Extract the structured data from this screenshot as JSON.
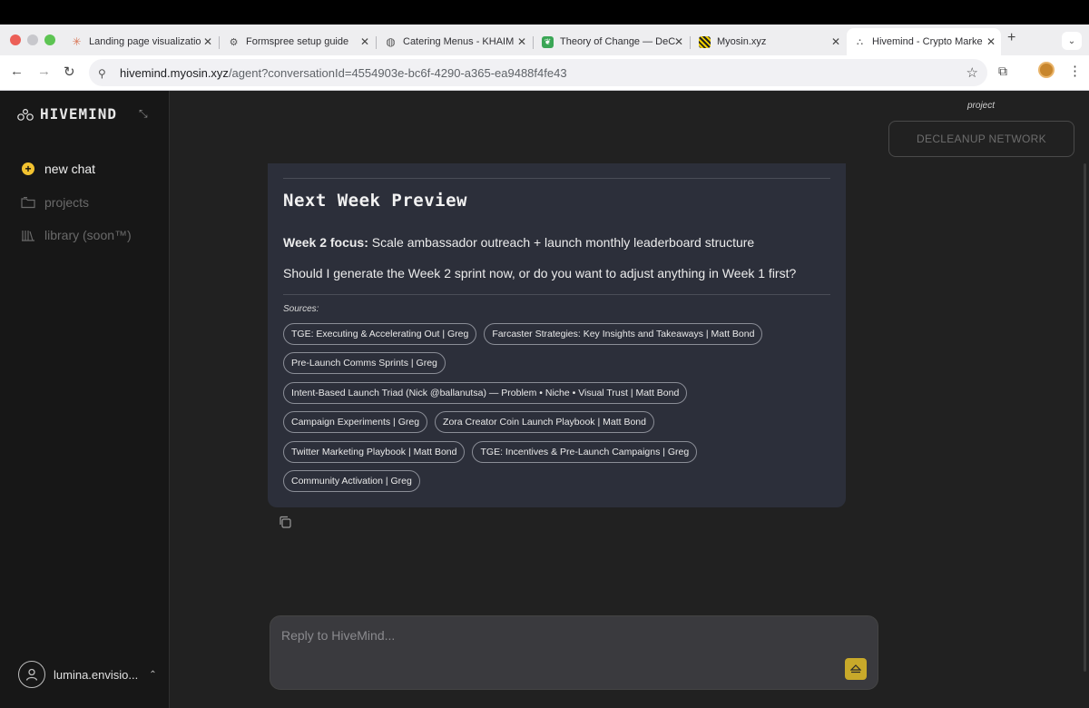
{
  "browser": {
    "tabs": [
      {
        "title": "Landing page visualizatio",
        "favicon": "claude-sunburst-icon",
        "active": false
      },
      {
        "title": "Formspree setup guide",
        "favicon": "openai-icon",
        "active": false
      },
      {
        "title": "Catering Menus - KHAIM",
        "favicon": "globe-icon",
        "active": false
      },
      {
        "title": "Theory of Change — DeC",
        "favicon": "green-leaf-icon",
        "active": false
      },
      {
        "title": "Myosin.xyz",
        "favicon": "myosin-stripes-icon",
        "active": false
      },
      {
        "title": "Hivemind - Crypto Marke",
        "favicon": "hivemind-icon",
        "active": true
      }
    ],
    "new_tab": "+",
    "url_host": "hivemind.myosin.xyz",
    "url_path": "/agent?conversationId=4554903e-bc6f-4290-a365-ea9488f4fe43"
  },
  "sidebar": {
    "brand": "HIVEMIND",
    "items": [
      {
        "label": "new chat",
        "icon": "plus-circle-icon"
      },
      {
        "label": "projects",
        "icon": "folder-icon"
      },
      {
        "label": "library (soon™)",
        "icon": "library-icon"
      }
    ],
    "user": "lumina.envisio..."
  },
  "header": {
    "project_label": "project",
    "project_name": "DECLEANUP NETWORK"
  },
  "message": {
    "heading": "Next Week Preview",
    "focus_label": "Week 2 focus:",
    "focus_text": "Scale ambassador outreach + launch monthly leaderboard structure",
    "question": "Should I generate the Week 2 sprint now, or do you want to adjust anything in Week 1 first?",
    "sources_label": "Sources:",
    "sources": [
      [
        "TGE: Executing & Accelerating Out | Greg",
        "Farcaster Strategies: Key Insights and Takeaways | Matt Bond"
      ],
      [
        "Pre-Launch Comms Sprints | Greg"
      ],
      [
        "Intent-Based Launch Triad (Nick @ballanutsa) — Problem • Niche • Visual Trust | Matt Bond"
      ],
      [
        "Campaign Experiments | Greg",
        "Zora Creator Coin Launch Playbook | Matt Bond"
      ],
      [
        "Twitter Marketing Playbook | Matt Bond",
        "TGE: Incentives & Pre-Launch Campaigns | Greg"
      ],
      [
        "Community Activation | Greg"
      ]
    ]
  },
  "composer": {
    "placeholder": "Reply to HiveMind..."
  },
  "colors": {
    "accent": "#f2c230",
    "send_button": "#c8a92a",
    "card_bg": "#2c2f3a"
  }
}
